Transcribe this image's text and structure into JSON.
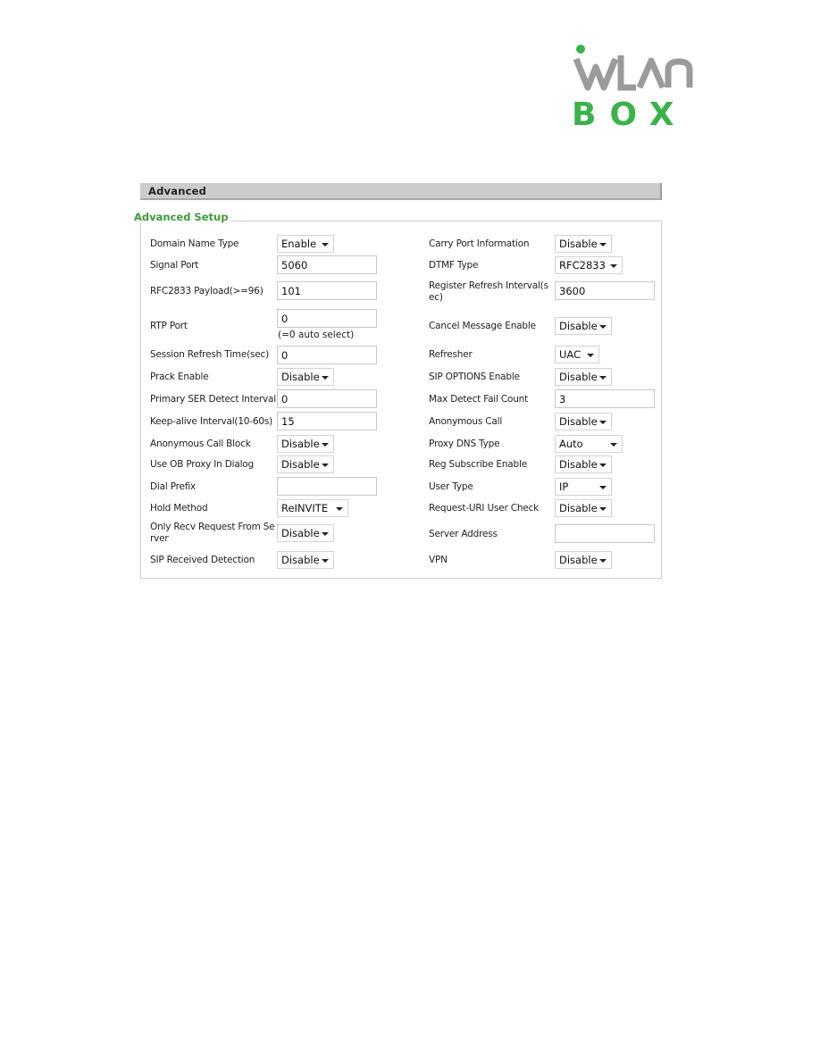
{
  "logo": {
    "text_top": "WLAN",
    "text_bottom": "BOX",
    "accent_color": "#3ab34a",
    "gray_color": "#9b9b9b"
  },
  "section": {
    "title": "Advanced"
  },
  "fieldset": {
    "legend": "Advanced Setup",
    "legend_color": "#3e9b3a"
  },
  "left": [
    {
      "label": "Domain Name Type",
      "type": "select",
      "value": "Enable"
    },
    {
      "label": "Signal Port",
      "type": "input",
      "value": "5060"
    },
    {
      "label": "RFC2833 Payload(>=96)",
      "type": "input",
      "value": "101"
    },
    {
      "label": "RTP Port",
      "type": "input",
      "value": "0",
      "hint": "(=0 auto select)"
    },
    {
      "label": "Session Refresh Time(sec)",
      "type": "input",
      "value": "0"
    },
    {
      "label": "Prack Enable",
      "type": "select",
      "value": "Disable"
    },
    {
      "label": "Primary SER Detect Interval",
      "type": "input",
      "value": "0"
    },
    {
      "label": "Keep-alive Interval(10-60s)",
      "type": "input",
      "value": "15"
    },
    {
      "label": "Anonymous Call Block",
      "type": "select",
      "value": "Disable"
    },
    {
      "label": "Use OB Proxy In Dialog",
      "type": "select",
      "value": "Disable"
    },
    {
      "label": "Dial Prefix",
      "type": "input",
      "value": ""
    },
    {
      "label": "Hold Method",
      "type": "select",
      "value": "ReINVITE"
    },
    {
      "label": "Only Recv Request From Se rver",
      "label_line1": "Only Recv Request From Se",
      "label_line2": "rver",
      "type": "select",
      "value": "Disable"
    },
    {
      "label": "SIP Received Detection",
      "type": "select",
      "value": "Disable"
    }
  ],
  "right": [
    {
      "label": "Carry Port Information",
      "type": "select",
      "value": "Disable"
    },
    {
      "label": "DTMF Type",
      "type": "select",
      "value": "RFC2833"
    },
    {
      "label": "Register Refresh Interval(s ec)",
      "label_line1": "Register Refresh Interval(s",
      "label_line2": "ec)",
      "type": "input",
      "value": "3600"
    },
    {
      "label": "Cancel Message Enable",
      "type": "select",
      "value": "Disable"
    },
    {
      "label": "Refresher",
      "type": "select",
      "value": "UAC"
    },
    {
      "label": "SIP OPTIONS Enable",
      "type": "select",
      "value": "Disable"
    },
    {
      "label": "Max Detect Fail Count",
      "type": "input",
      "value": "3"
    },
    {
      "label": "Anonymous Call",
      "type": "select",
      "value": "Disable"
    },
    {
      "label": "Proxy DNS Type",
      "type": "select",
      "value": "Auto"
    },
    {
      "label": "Reg Subscribe Enable",
      "type": "select",
      "value": "Disable"
    },
    {
      "label": "User Type",
      "type": "select",
      "value": "IP"
    },
    {
      "label": "Request-URI User Check",
      "type": "select",
      "value": "Disable"
    },
    {
      "label": "Server Address",
      "type": "input",
      "value": ""
    },
    {
      "label": "VPN",
      "type": "select",
      "value": "Disable"
    }
  ]
}
